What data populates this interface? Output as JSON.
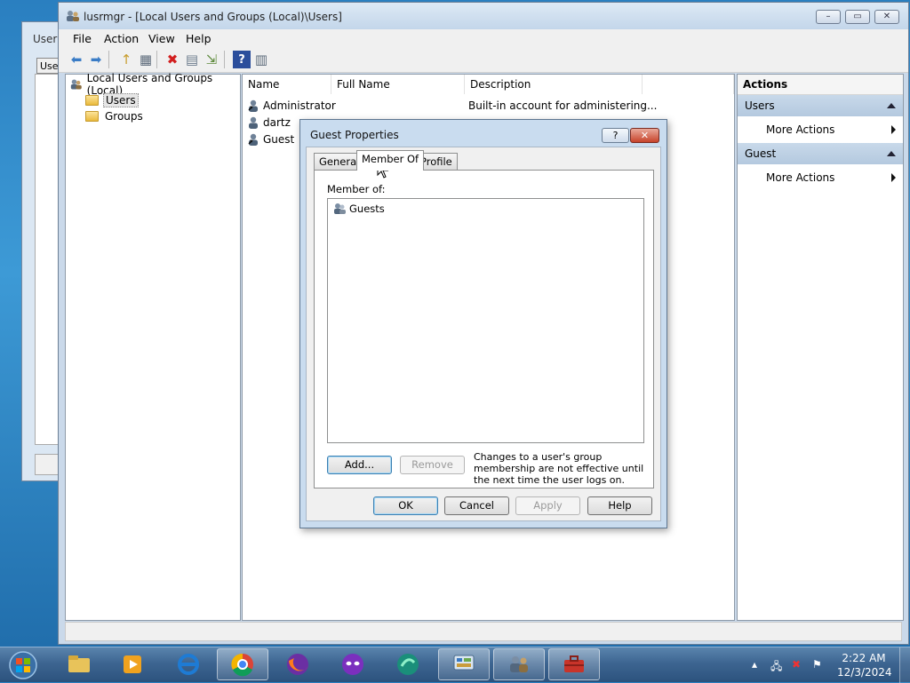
{
  "bg_window": {
    "title": "User",
    "tab": "User"
  },
  "main_window": {
    "title": "lusrmgr - [Local Users and Groups (Local)\\Users]",
    "caption_buttons": {
      "minimize": "–",
      "restore": "▭",
      "close": "✕"
    }
  },
  "menu": [
    "File",
    "Action",
    "View",
    "Help"
  ],
  "toolbar": [
    {
      "name": "back-arrow-icon",
      "glyph": "⬅",
      "color": "#3a7cc6"
    },
    {
      "name": "forward-arrow-icon",
      "glyph": "➡",
      "color": "#3a7cc6"
    },
    {
      "name": "up-folder-icon",
      "glyph": "↑",
      "color": "#c89c2c"
    },
    {
      "name": "show-hide-tree-icon",
      "glyph": "▦",
      "color": "#5d6b7b"
    },
    {
      "name": "delete-icon",
      "glyph": "✖",
      "color": "#d21f1f"
    },
    {
      "name": "properties-icon",
      "glyph": "▤",
      "color": "#6b7b8c"
    },
    {
      "name": "export-list-icon",
      "glyph": "⇲",
      "color": "#5e8a3c"
    },
    {
      "name": "help-icon",
      "glyph": "?",
      "color": "#ffffff"
    },
    {
      "name": "show-hide-action-pane-icon",
      "glyph": "▥",
      "color": "#5d6b7b"
    }
  ],
  "tree": {
    "root": "Local Users and Groups (Local)",
    "children": [
      "Users",
      "Groups"
    ],
    "selected": "Users"
  },
  "list": {
    "columns": [
      "Name",
      "Full Name",
      "Description"
    ],
    "rows": [
      {
        "name": "Administrator",
        "full_name": "",
        "description": "Built-in account for administering..."
      },
      {
        "name": "dartz",
        "full_name": "",
        "description": ""
      },
      {
        "name": "Guest",
        "full_name": "",
        "description": ""
      }
    ]
  },
  "actions": {
    "header": "Actions",
    "groups": [
      {
        "title": "Users",
        "items": [
          "More Actions"
        ]
      },
      {
        "title": "Guest",
        "items": [
          "More Actions"
        ]
      }
    ]
  },
  "dialog": {
    "title": "Guest Properties",
    "help_button": "?",
    "close_button": "✕",
    "tabs": [
      "General",
      "Member Of",
      "Profile"
    ],
    "active_tab": "Member Of",
    "member_of_label": "Member of:",
    "members": [
      "Guests"
    ],
    "add_button": "Add...",
    "remove_button": "Remove",
    "note": "Changes to a user's group membership are not effective until the next time the user logs on.",
    "ok_button": "OK",
    "cancel_button": "Cancel",
    "apply_button": "Apply",
    "help_text_button": "Help"
  },
  "taskbar": {
    "apps": [
      {
        "name": "file-explorer-icon",
        "open": false
      },
      {
        "name": "media-player-icon",
        "open": false
      },
      {
        "name": "internet-explorer-icon",
        "open": false
      },
      {
        "name": "chrome-icon",
        "open": true
      },
      {
        "name": "firefox-icon",
        "open": false
      },
      {
        "name": "mask-app-icon",
        "open": false
      },
      {
        "name": "browser-globe-icon",
        "open": false
      },
      {
        "name": "control-panel-icon",
        "open": true
      },
      {
        "name": "users-management-icon",
        "open": true
      },
      {
        "name": "toolbox-icon",
        "open": true
      }
    ],
    "time": "2:22 AM",
    "date": "12/3/2024"
  }
}
